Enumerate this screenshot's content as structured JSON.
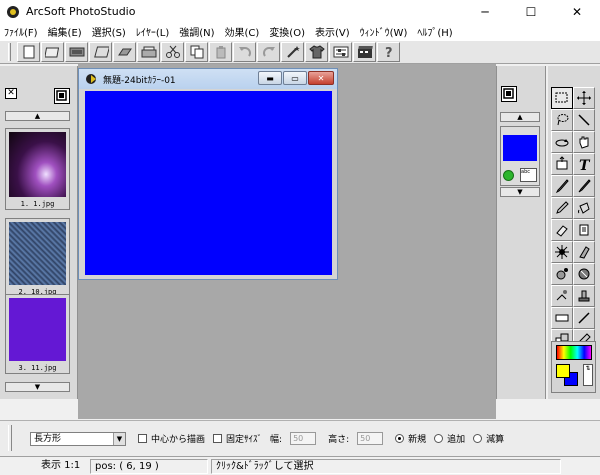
{
  "window": {
    "title": "ArcSoft PhotoStudio",
    "minimize": "─",
    "maximize": "☐",
    "close": "✕"
  },
  "menu": [
    "ﾌｧｲﾙ(F)",
    "編集(E)",
    "選択(S)",
    "ﾚｲﾔｰ(L)",
    "強調(N)",
    "効果(C)",
    "変換(O)",
    "表示(V)",
    "ｳｨﾝﾄﾞｳ(W)",
    "ﾍﾙﾌﾟ(H)"
  ],
  "toolbar": {
    "icons": [
      "new-file-icon",
      "open-file-icon",
      "acquire-icon",
      "print-icon",
      "save-icon",
      "scanner-icon",
      "cut-icon",
      "copy-icon",
      "paste-icon",
      "undo-icon",
      "redo-icon",
      "magic-wand-icon",
      "tshirt-icon",
      "adjust-icon",
      "film-icon",
      "help-icon"
    ]
  },
  "album": {
    "close": "✕",
    "thumbnails": [
      {
        "label": "1. 1.jpg",
        "colors": [
          "#1a0a1e",
          "#8a3a9a",
          "#e6d0f0"
        ]
      },
      {
        "label": "2. 10.jpg",
        "colors": [
          "#20304a",
          "#5070a0",
          "#a0b4d0"
        ]
      },
      {
        "label": "3. 11.jpg",
        "colors": [
          "#5a10c8",
          "#6a20d8",
          "#5a10c8"
        ]
      }
    ]
  },
  "document": {
    "title": "無題-24bitｶﾗｰ-01",
    "canvas_color": "#0000ff"
  },
  "navigator": {
    "preview_color": "#0000ff",
    "doc_icon_text": "abc"
  },
  "tools": [
    "rect-select-icon",
    "move-icon",
    "lasso-icon",
    "line-icon",
    "rotate-icon",
    "hand-icon",
    "crop-icon",
    "text-icon",
    "brush-icon",
    "airbrush-icon",
    "pencil-icon",
    "bucket-icon",
    "eraser-icon",
    "clone-icon",
    "sparkle-icon",
    "smudge-icon",
    "dodge-icon",
    "burn-icon",
    "effects-icon",
    "stamp-icon",
    "rectangle-icon",
    "straight-line-icon",
    "shape-icon",
    "eyedropper-icon",
    "grid-icon",
    "trash-icon"
  ],
  "colors": {
    "foreground": "#ffff00",
    "background": "#0000ff"
  },
  "options": {
    "shape_value": "長方形",
    "center_label": "中心から描画",
    "fixed_size_label": "固定ｻｲｽﾞ",
    "width_label": "幅:",
    "width_value": "50",
    "height_label": "高さ:",
    "height_value": "50",
    "mode_new": "新規",
    "mode_add": "追加",
    "mode_subtract": "減算"
  },
  "status": {
    "zoom": "表示 1:1",
    "pos": "pos: ( 6, 19 )",
    "hint": "ｸﾘｯｸ&ﾄﾞﾗｯｸﾞして選択"
  }
}
